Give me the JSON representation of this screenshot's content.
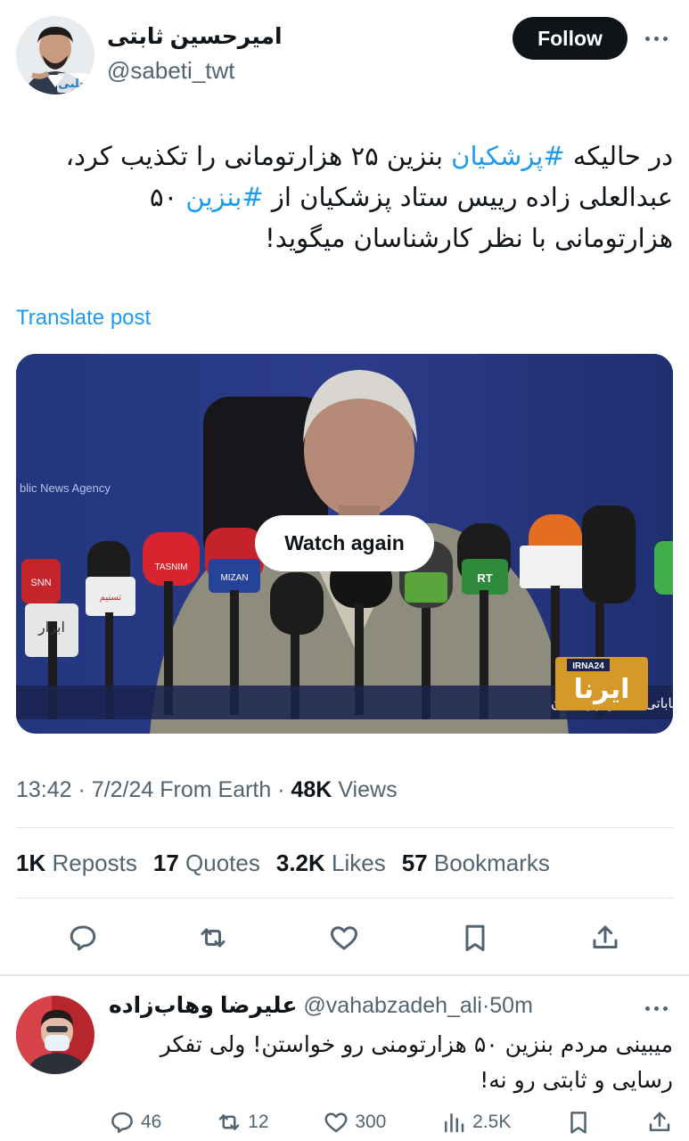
{
  "tweet": {
    "author_name": "امیرحسین ثابتی",
    "author_handle": "@sabeti_twt",
    "avatar_watermark": "حلبی",
    "follow_label": "Follow",
    "text": {
      "line1_a": "در حالیکه ",
      "line1_hashtag": "#پزشکیان",
      "line1_b": " بنزین ۲۵ هزارتومانی را تکذیب کرد،",
      "line2_a": "عبدالعلی زاده رییس ستاد پزشکیان از ",
      "line2_hashtag": "#بنزین",
      "line2_b": " ۵۰",
      "line3": "هزارتومانی با نظر کارشناسان میگوید!"
    },
    "translate_label": "Translate post",
    "video": {
      "watch_again_label": "Watch again",
      "caption": "کنفرانس مطبوعاتی علی عبدالعلی زاده، رئیس ستاد انتخاباتی مسعود پزشکیان",
      "logo_text": "ایرنا",
      "logo_badge": "IRNA24",
      "banner_text": "blic News Agency",
      "mic_labels": [
        "ابرار",
        "تسنیم",
        "TASNIM",
        "MIZAN",
        "RT",
        "SNN"
      ]
    },
    "meta": {
      "time": "13:42",
      "date": "7/2/24",
      "source": "From Earth",
      "views_count": "48K",
      "views_label": "Views"
    },
    "stats": {
      "reposts_count": "1K",
      "reposts_label": "Reposts",
      "quotes_count": "17",
      "quotes_label": "Quotes",
      "likes_count": "3.2K",
      "likes_label": "Likes",
      "bookmarks_count": "57",
      "bookmarks_label": "Bookmarks"
    }
  },
  "reply": {
    "author_name": "علیرضا وهاب‌زاده",
    "author_handle": "@vahabzadeh_ali",
    "time": "50m",
    "line1": "میبینی مردم بنزین ۵۰ هزارتومنی رو خواستن! ولی تفکر",
    "line2": "رسایی و ثابتی رو نه!",
    "replies": "46",
    "reposts": "12",
    "likes": "300",
    "views": "2.5K"
  },
  "colors": {
    "accent": "#1d9bf0",
    "text": "#0f1419",
    "muted": "#536471",
    "divider": "#e1e6ea"
  },
  "icons": [
    "more-icon",
    "reply-icon",
    "repost-icon",
    "like-icon",
    "bookmark-icon",
    "share-icon",
    "views-icon"
  ]
}
